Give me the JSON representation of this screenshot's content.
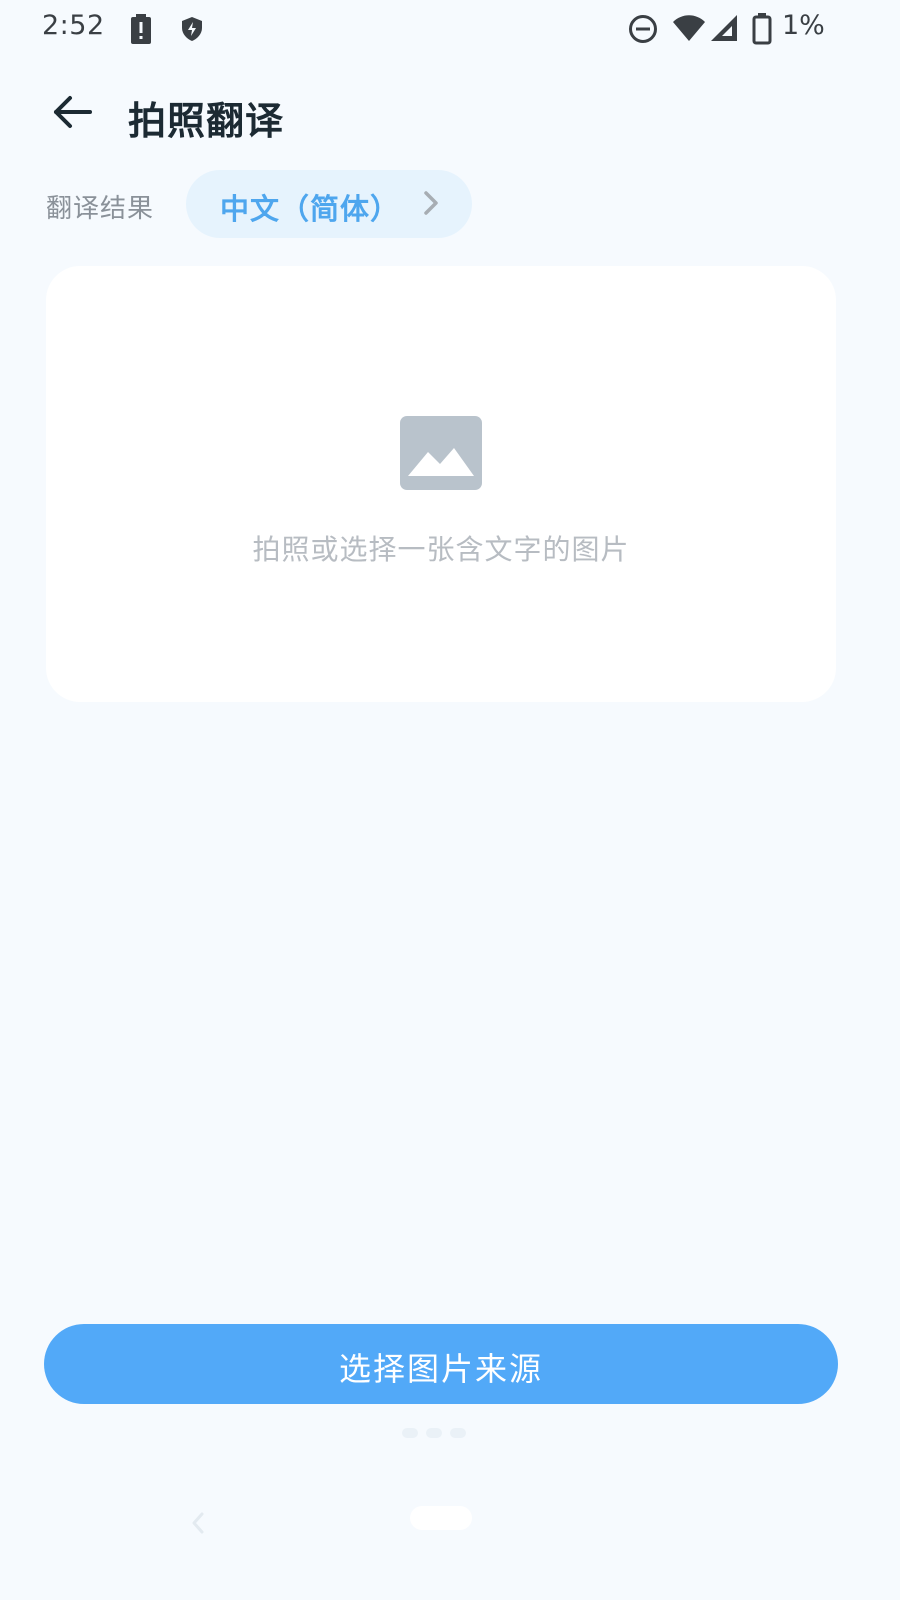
{
  "status_bar": {
    "time": "2:52",
    "battery_percent": "1%",
    "icons": [
      "battery-alert-icon",
      "shield-icon",
      "do-not-disturb-icon",
      "wifi-icon",
      "signal-icon",
      "battery-icon"
    ]
  },
  "header": {
    "back_icon": "arrow-left-icon",
    "title": "拍照翻译"
  },
  "language": {
    "label": "翻译结果",
    "selected": "中文（简体）",
    "chevron_icon": "chevron-right-icon"
  },
  "image_card": {
    "icon": "image-placeholder-icon",
    "placeholder": "拍照或选择一张含文字的图片"
  },
  "actions": {
    "select_source_label": "选择图片来源"
  },
  "colors": {
    "background": "#f6fafe",
    "accent": "#52a9f8",
    "chip_background": "#e6f3fd",
    "chip_text": "#4ea6ee"
  }
}
